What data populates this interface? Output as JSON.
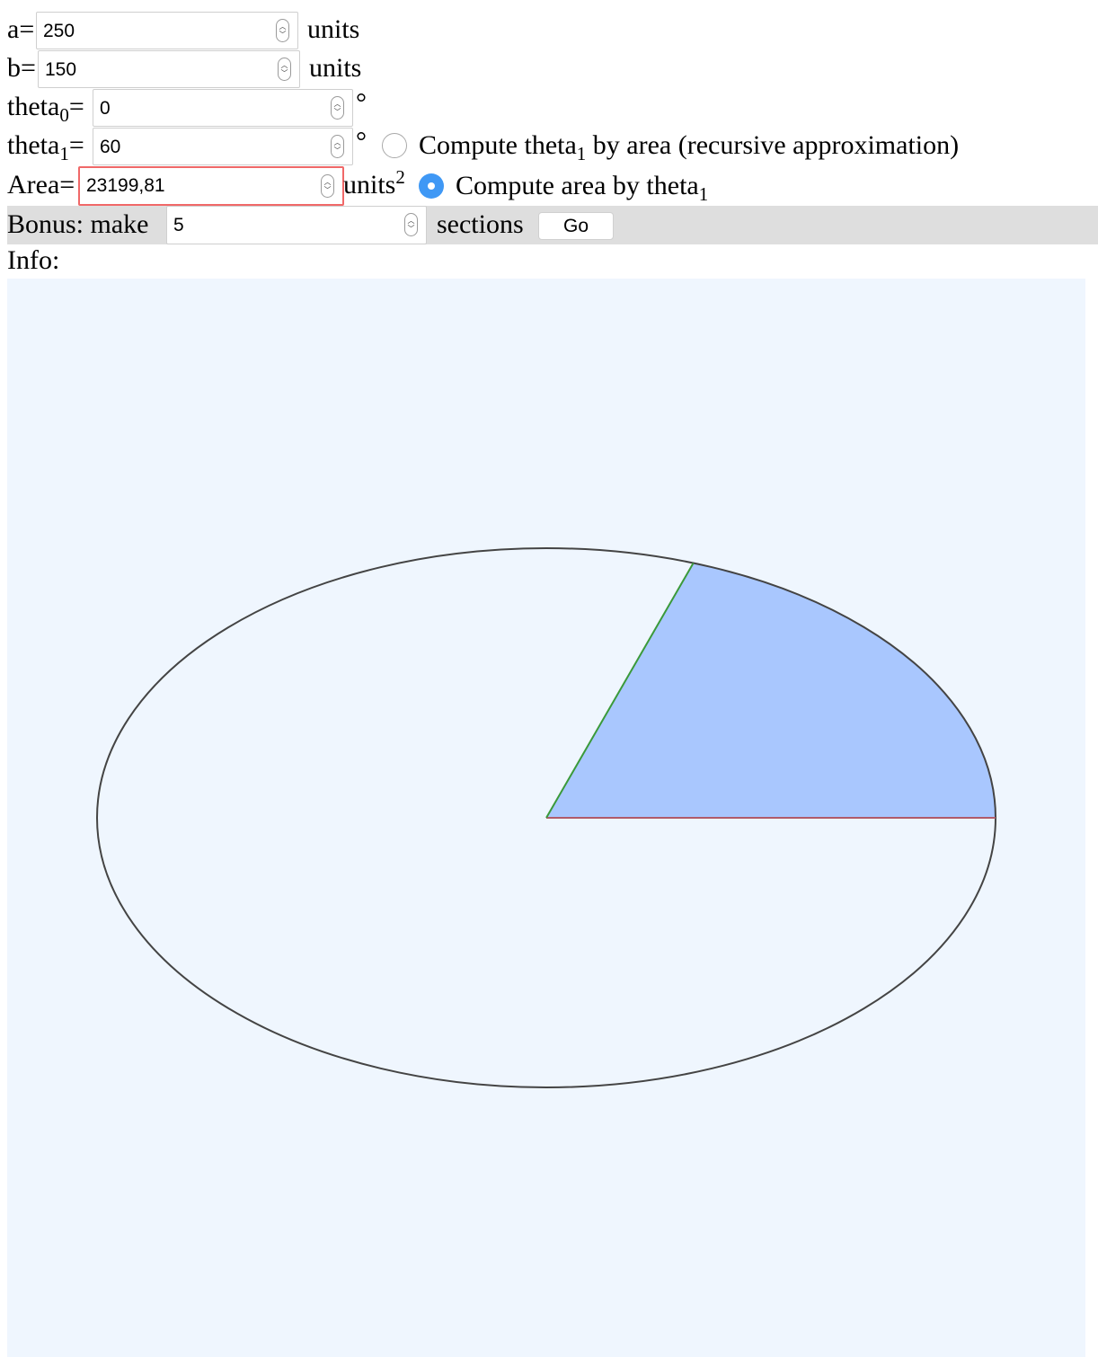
{
  "params": {
    "a": {
      "label": "a=",
      "value": "250",
      "unit": "units"
    },
    "b": {
      "label": "b=",
      "value": "150",
      "unit": "units"
    },
    "theta0": {
      "label_main": "theta",
      "label_sub": "0",
      "label_eq": "=",
      "value": "0",
      "unit": "°"
    },
    "theta1": {
      "label_main": "theta",
      "label_sub": "1",
      "label_eq": "=",
      "value": "60",
      "unit": "°"
    },
    "area": {
      "label": "Area=",
      "value": "23199,81",
      "unit_main": "units",
      "unit_sup": "2"
    }
  },
  "modes": {
    "by_area": {
      "text_main": "Compute theta",
      "text_sub": "1",
      "text_rest": " by area (recursive approximation)",
      "selected": false
    },
    "by_theta": {
      "text_main": "Compute area by theta",
      "text_sub": "1",
      "selected": true
    }
  },
  "bonus": {
    "label": "Bonus: make",
    "value": "5",
    "suffix": "sections",
    "button": "Go"
  },
  "info": {
    "label": "Info:"
  },
  "drawing": {
    "a": 250,
    "b": 150,
    "theta0_deg": 0,
    "theta1_deg": 60,
    "colors": {
      "background": "#eff6fe",
      "ellipse": "#444444",
      "sector_fill": "#a9c7fe",
      "start_ray": "#b05c6a",
      "end_ray": "#3a9a3a",
      "bonus_bar": "#dedede",
      "area_alert": "#f06868"
    }
  }
}
